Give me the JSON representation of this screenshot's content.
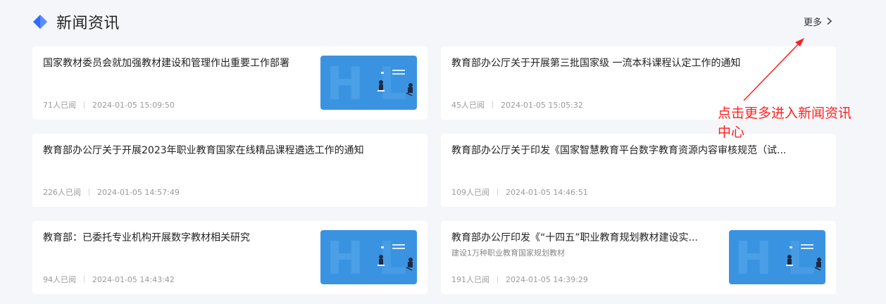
{
  "section": {
    "title": "新闻资讯",
    "more_label": "更多",
    "icons": {
      "title": "diamond-icon",
      "more": "chevron-right-icon"
    },
    "accent": "#2f6bff"
  },
  "news": [
    {
      "title": "国家教材委员会就加强教材建设和管理作出重要工作部署",
      "subtitle": "",
      "views": "71人已阅",
      "time": "2024-01-05 15:09:50",
      "has_thumb": true
    },
    {
      "title": "教育部办公厅关于开展第三批国家级 一流本科课程认定工作的通知",
      "subtitle": "",
      "views": "45人已阅",
      "time": "2024-01-05 15:05:32",
      "has_thumb": false
    },
    {
      "title": "教育部办公厅关于开展2023年职业教育国家在线精品课程遴选工作的通知",
      "subtitle": "",
      "views": "226人已阅",
      "time": "2024-01-05 14:57:49",
      "has_thumb": false
    },
    {
      "title": "教育部办公厅关于印发《国家智慧教育平台数字教育资源内容审核规范（试...",
      "subtitle": "",
      "views": "109人已阅",
      "time": "2024-01-05 14:46:51",
      "has_thumb": false
    },
    {
      "title": "教育部：已委托专业机构开展数字教材相关研究",
      "subtitle": "",
      "views": "94人已阅",
      "time": "2024-01-05 14:43:42",
      "has_thumb": true
    },
    {
      "title": "教育部办公厅印发《“十四五”职业教育规划教材建设实...",
      "subtitle": "建设1万种职业教育国家规划教材",
      "views": "191人已阅",
      "time": "2024-01-05 14:39:29",
      "has_thumb": true
    }
  ],
  "annotation": {
    "text": "点击更多进入新闻资讯中心",
    "color": "#ff1f1f"
  },
  "thumb_colors": {
    "bg": "#3a93e0",
    "light": "#5aa9ec"
  }
}
